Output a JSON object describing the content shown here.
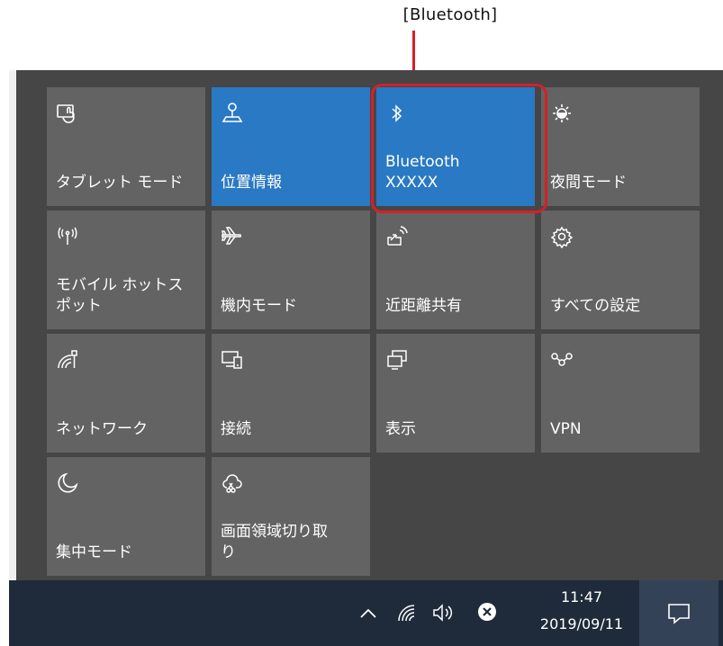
{
  "callout": {
    "label": "[Bluetooth]"
  },
  "tiles": [
    {
      "label": "タブレット モード",
      "icon": "tablet-mode-icon",
      "active": false
    },
    {
      "label": "位置情報",
      "icon": "location-icon",
      "active": true
    },
    {
      "label": "Bluetooth\nXXXXX",
      "icon": "bluetooth-icon",
      "active": true
    },
    {
      "label": "夜間モード",
      "icon": "night-light-icon",
      "active": false
    },
    {
      "label": "モバイル ホットス\nポット",
      "icon": "mobile-hotspot-icon",
      "active": false
    },
    {
      "label": "機内モード",
      "icon": "airplane-icon",
      "active": false
    },
    {
      "label": "近距離共有",
      "icon": "nearby-sharing-icon",
      "active": false
    },
    {
      "label": "すべての設定",
      "icon": "gear-icon",
      "active": false
    },
    {
      "label": "ネットワーク",
      "icon": "network-icon",
      "active": false
    },
    {
      "label": "接続",
      "icon": "connect-icon",
      "active": false
    },
    {
      "label": "表示",
      "icon": "project-icon",
      "active": false
    },
    {
      "label": "VPN",
      "icon": "vpn-icon",
      "active": false
    },
    {
      "label": "集中モード",
      "icon": "focus-assist-icon",
      "active": false
    },
    {
      "label": "画面領域切り取\nり",
      "icon": "snip-icon",
      "active": false
    }
  ],
  "taskbar": {
    "time": "11:47",
    "date": "2019/09/11",
    "icons": [
      "chevron-up-icon",
      "wifi-icon",
      "volume-icon",
      "error-icon",
      "action-center-icon"
    ]
  },
  "colors": {
    "tile": "#636363",
    "tile_active": "#2a79c4",
    "panel": "#464646",
    "taskbar": "#1f2b3b",
    "highlight": "#d4202a"
  }
}
